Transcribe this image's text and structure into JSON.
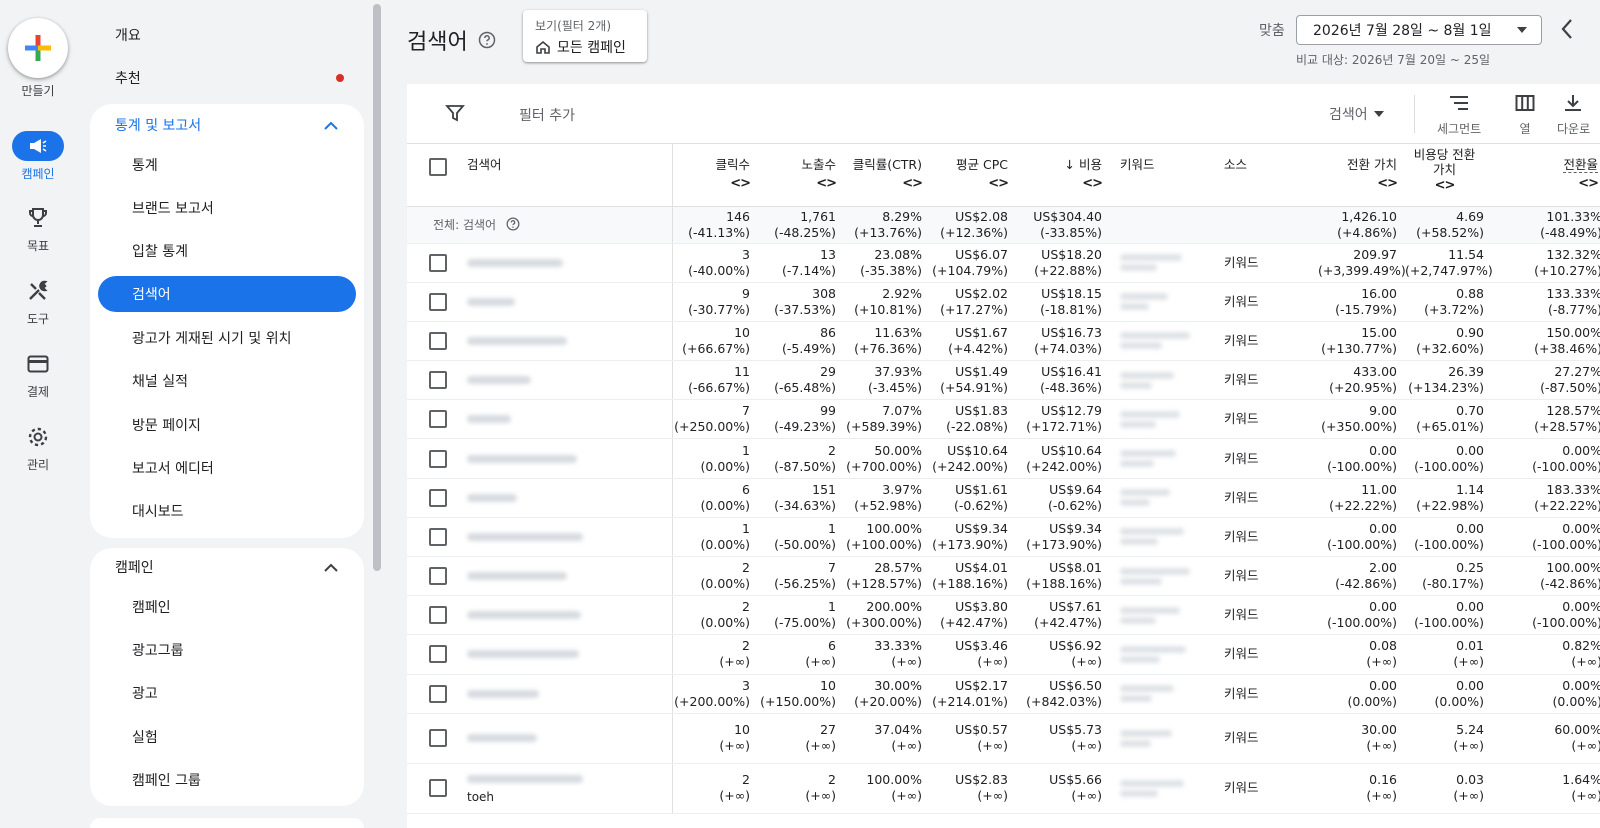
{
  "rail": {
    "create_label": "만들기",
    "items": [
      {
        "label": "캠페인",
        "icon": "megaphone-icon",
        "active": true
      },
      {
        "label": "목표",
        "icon": "trophy-icon",
        "active": false
      },
      {
        "label": "도구",
        "icon": "tools-icon",
        "active": false
      },
      {
        "label": "결제",
        "icon": "credit-card-icon",
        "active": false
      },
      {
        "label": "관리",
        "icon": "gear-icon",
        "active": false
      }
    ]
  },
  "sidebar": {
    "overview": "개요",
    "recommendations": "추천",
    "reports_section": {
      "title": "통계 및 보고서",
      "items": [
        "통계",
        "브랜드 보고서",
        "입찰 통계",
        "검색어",
        "광고가 게재된 시기 및 위치",
        "채널 실적",
        "방문 페이지",
        "보고서 에디터",
        "대시보드"
      ],
      "active_index": 3
    },
    "campaign_section": {
      "title": "캠페인",
      "items": [
        "캠페인",
        "광고그룹",
        "광고",
        "실험",
        "캠페인 그룹"
      ]
    }
  },
  "header": {
    "title": "검색어",
    "view_label": "보기(필터 2개)",
    "view_value": "모든 캠페인",
    "date_label": "맞춤",
    "date_range": "2026년 7월 28일 ~ 8월 1일",
    "compare": "비교 대상: 2026년 7월 20일 ~ 25일"
  },
  "toolbar": {
    "filter_add": "필터 추가",
    "segment_select": "검색어",
    "segment_label": "세그먼트",
    "columns_label": "열",
    "download_label": "다운로"
  },
  "table": {
    "headers": {
      "search_term": "검색어",
      "clicks": "클릭수",
      "impressions": "노출수",
      "ctr": "클릭률(CTR)",
      "avg_cpc": "평균 CPC",
      "cost": "비용",
      "keyword": "키워드",
      "source": "소스",
      "conv_value": "전환 가치",
      "value_per_cost_1": "비용당 전환",
      "value_per_cost_2": "가치",
      "conv_rate": "전환율"
    },
    "total": {
      "label": "전체: 검색어",
      "clicks": [
        "146",
        "(-41.13%)"
      ],
      "impressions": [
        "1,761",
        "(-48.25%)"
      ],
      "ctr": [
        "8.29%",
        "(+13.76%)"
      ],
      "avg_cpc": [
        "US$2.08",
        "(+12.36%)"
      ],
      "cost": [
        "US$304.40",
        "(-33.85%)"
      ],
      "conv_value": [
        "1,426.10",
        "(+4.86%)"
      ],
      "value_per_cost": [
        "4.69",
        "(+58.52%)"
      ],
      "conv_rate": [
        "101.33%",
        "(-48.49%)"
      ]
    },
    "rows": [
      {
        "clicks": [
          "3",
          "(-40.00%)"
        ],
        "impr": [
          "13",
          "(-7.14%)"
        ],
        "ctr": [
          "23.08%",
          "(-35.38%)"
        ],
        "cpc": [
          "US$6.07",
          "(+104.79%)"
        ],
        "cost": [
          "US$18.20",
          "(+22.88%)"
        ],
        "source": "키워드",
        "cv": [
          "209.97",
          "(+3,399.49%)"
        ],
        "vpc": [
          "11.54",
          "(+2,747.97%)"
        ],
        "cr": [
          "132.32%",
          "(+10.27%)"
        ]
      },
      {
        "clicks": [
          "9",
          "(-30.77%)"
        ],
        "impr": [
          "308",
          "(-37.53%)"
        ],
        "ctr": [
          "2.92%",
          "(+10.81%)"
        ],
        "cpc": [
          "US$2.02",
          "(+17.27%)"
        ],
        "cost": [
          "US$18.15",
          "(-18.81%)"
        ],
        "source": "키워드",
        "cv": [
          "16.00",
          "(-15.79%)"
        ],
        "vpc": [
          "0.88",
          "(+3.72%)"
        ],
        "cr": [
          "133.33%",
          "(-8.77%)"
        ]
      },
      {
        "clicks": [
          "10",
          "(+66.67%)"
        ],
        "impr": [
          "86",
          "(-5.49%)"
        ],
        "ctr": [
          "11.63%",
          "(+76.36%)"
        ],
        "cpc": [
          "US$1.67",
          "(+4.42%)"
        ],
        "cost": [
          "US$16.73",
          "(+74.03%)"
        ],
        "source": "키워드",
        "cv": [
          "15.00",
          "(+130.77%)"
        ],
        "vpc": [
          "0.90",
          "(+32.60%)"
        ],
        "cr": [
          "150.00%",
          "(+38.46%)"
        ]
      },
      {
        "clicks": [
          "11",
          "(-66.67%)"
        ],
        "impr": [
          "29",
          "(-65.48%)"
        ],
        "ctr": [
          "37.93%",
          "(-3.45%)"
        ],
        "cpc": [
          "US$1.49",
          "(+54.91%)"
        ],
        "cost": [
          "US$16.41",
          "(-48.36%)"
        ],
        "source": "키워드",
        "cv": [
          "433.00",
          "(+20.95%)"
        ],
        "vpc": [
          "26.39",
          "(+134.23%)"
        ],
        "cr": [
          "27.27%",
          "(-87.50%)"
        ]
      },
      {
        "clicks": [
          "7",
          "(+250.00%)"
        ],
        "impr": [
          "99",
          "(-49.23%)"
        ],
        "ctr": [
          "7.07%",
          "(+589.39%)"
        ],
        "cpc": [
          "US$1.83",
          "(-22.08%)"
        ],
        "cost": [
          "US$12.79",
          "(+172.71%)"
        ],
        "source": "키워드",
        "cv": [
          "9.00",
          "(+350.00%)"
        ],
        "vpc": [
          "0.70",
          "(+65.01%)"
        ],
        "cr": [
          "128.57%",
          "(+28.57%)"
        ]
      },
      {
        "clicks": [
          "1",
          "(0.00%)"
        ],
        "impr": [
          "2",
          "(-87.50%)"
        ],
        "ctr": [
          "50.00%",
          "(+700.00%)"
        ],
        "cpc": [
          "US$10.64",
          "(+242.00%)"
        ],
        "cost": [
          "US$10.64",
          "(+242.00%)"
        ],
        "source": "키워드",
        "cv": [
          "0.00",
          "(-100.00%)"
        ],
        "vpc": [
          "0.00",
          "(-100.00%)"
        ],
        "cr": [
          "0.00%",
          "(-100.00%)"
        ]
      },
      {
        "clicks": [
          "6",
          "(0.00%)"
        ],
        "impr": [
          "151",
          "(-34.63%)"
        ],
        "ctr": [
          "3.97%",
          "(+52.98%)"
        ],
        "cpc": [
          "US$1.61",
          "(-0.62%)"
        ],
        "cost": [
          "US$9.64",
          "(-0.62%)"
        ],
        "source": "키워드",
        "cv": [
          "11.00",
          "(+22.22%)"
        ],
        "vpc": [
          "1.14",
          "(+22.98%)"
        ],
        "cr": [
          "183.33%",
          "(+22.22%)"
        ]
      },
      {
        "clicks": [
          "1",
          "(0.00%)"
        ],
        "impr": [
          "1",
          "(-50.00%)"
        ],
        "ctr": [
          "100.00%",
          "(+100.00%)"
        ],
        "cpc": [
          "US$9.34",
          "(+173.90%)"
        ],
        "cost": [
          "US$9.34",
          "(+173.90%)"
        ],
        "source": "키워드",
        "cv": [
          "0.00",
          "(-100.00%)"
        ],
        "vpc": [
          "0.00",
          "(-100.00%)"
        ],
        "cr": [
          "0.00%",
          "(-100.00%)"
        ]
      },
      {
        "clicks": [
          "2",
          "(0.00%)"
        ],
        "impr": [
          "7",
          "(-56.25%)"
        ],
        "ctr": [
          "28.57%",
          "(+128.57%)"
        ],
        "cpc": [
          "US$4.01",
          "(+188.16%)"
        ],
        "cost": [
          "US$8.01",
          "(+188.16%)"
        ],
        "source": "키워드",
        "cv": [
          "2.00",
          "(-42.86%)"
        ],
        "vpc": [
          "0.25",
          "(-80.17%)"
        ],
        "cr": [
          "100.00%",
          "(-42.86%)"
        ]
      },
      {
        "clicks": [
          "2",
          "(0.00%)"
        ],
        "impr": [
          "1",
          "(-75.00%)"
        ],
        "ctr": [
          "200.00%",
          "(+300.00%)"
        ],
        "cpc": [
          "US$3.80",
          "(+42.47%)"
        ],
        "cost": [
          "US$7.61",
          "(+42.47%)"
        ],
        "source": "키워드",
        "cv": [
          "0.00",
          "(-100.00%)"
        ],
        "vpc": [
          "0.00",
          "(-100.00%)"
        ],
        "cr": [
          "0.00%",
          "(-100.00%)"
        ]
      },
      {
        "clicks": [
          "2",
          "(+∞)"
        ],
        "impr": [
          "6",
          "(+∞)"
        ],
        "ctr": [
          "33.33%",
          "(+∞)"
        ],
        "cpc": [
          "US$3.46",
          "(+∞)"
        ],
        "cost": [
          "US$6.92",
          "(+∞)"
        ],
        "source": "키워드",
        "cv": [
          "0.08",
          "(+∞)"
        ],
        "vpc": [
          "0.01",
          "(+∞)"
        ],
        "cr": [
          "0.82%",
          "(+∞)"
        ]
      },
      {
        "clicks": [
          "3",
          "(+200.00%)"
        ],
        "impr": [
          "10",
          "(+150.00%)"
        ],
        "ctr": [
          "30.00%",
          "(+20.00%)"
        ],
        "cpc": [
          "US$2.17",
          "(+214.01%)"
        ],
        "cost": [
          "US$6.50",
          "(+842.03%)"
        ],
        "source": "키워드",
        "cv": [
          "0.00",
          "(0.00%)"
        ],
        "vpc": [
          "0.00",
          "(0.00%)"
        ],
        "cr": [
          "0.00%",
          "(0.00%)"
        ]
      },
      {
        "clicks": [
          "10",
          "(+∞)"
        ],
        "impr": [
          "27",
          "(+∞)"
        ],
        "ctr": [
          "37.04%",
          "(+∞)"
        ],
        "cpc": [
          "US$0.57",
          "(+∞)"
        ],
        "cost": [
          "US$5.73",
          "(+∞)"
        ],
        "source": "키워드",
        "cv": [
          "30.00",
          "(+∞)"
        ],
        "vpc": [
          "5.24",
          "(+∞)"
        ],
        "cr": [
          "60.00%",
          "(+∞)"
        ]
      },
      {
        "term_tail": "toeh",
        "clicks": [
          "2",
          "(+∞)"
        ],
        "impr": [
          "2",
          "(+∞)"
        ],
        "ctr": [
          "100.00%",
          "(+∞)"
        ],
        "cpc": [
          "US$2.83",
          "(+∞)"
        ],
        "cost": [
          "US$5.66",
          "(+∞)"
        ],
        "source": "키워드",
        "cv": [
          "0.16",
          "(+∞)"
        ],
        "vpc": [
          "0.03",
          "(+∞)"
        ],
        "cr": [
          "1.64%",
          "(+∞)"
        ]
      }
    ]
  },
  "colors": {
    "accent": "#1a73e8",
    "alert": "#d93025"
  }
}
